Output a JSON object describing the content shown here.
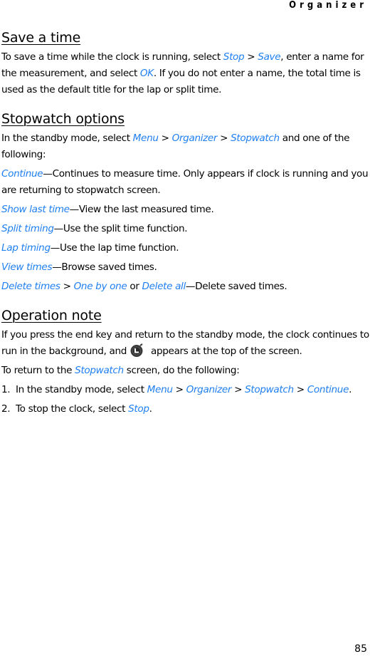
{
  "header": {
    "running_head": "Organizer"
  },
  "footer": {
    "page_number": "85"
  },
  "colors": {
    "link": "#1f7ff0",
    "text": "#000000"
  },
  "sections": {
    "save": {
      "title": "Save a time",
      "p1": {
        "t1": "To save a time while the clock is running, select ",
        "l1": "Stop",
        "t2": " > ",
        "l2": "Save",
        "t3": ", enter a name for the measurement, and select ",
        "l3": "OK",
        "t4": ". If you do not enter a name, the total time is used as the default title for the lap or split time."
      }
    },
    "options": {
      "title": "Stopwatch options",
      "intro": {
        "t1": "In the standby mode, select ",
        "l1": "Menu",
        "t2": " > ",
        "l2": "Organizer",
        "t3": " > ",
        "l3": "Stopwatch",
        "t4": " and one of the following:"
      },
      "items": [
        {
          "term": "Continue",
          "desc": "—Continues to measure time. Only appears if clock is running and you are returning to stopwatch screen."
        },
        {
          "term": "Show last time",
          "desc": "—View the last measured time."
        },
        {
          "term": "Split timing",
          "desc": "—Use the split time function."
        },
        {
          "term": "Lap timing",
          "desc": "—Use the lap time function."
        },
        {
          "term": "View times",
          "desc": "—Browse saved times."
        }
      ],
      "delete_item": {
        "l1": "Delete times",
        "t1": " > ",
        "l2": "One by one",
        "t2": " or ",
        "l3": "Delete all",
        "desc": "—Delete saved times."
      }
    },
    "note": {
      "title": "Operation note",
      "p1": {
        "t1": "If you press the end key and return to the standby mode, the clock continues to run in the background, and",
        "icon": "stopwatch-indicator-icon",
        "t2": "appears at the top of the screen."
      },
      "p2": {
        "t1": "To return to the ",
        "l1": "Stopwatch",
        "t2": " screen, do the following:"
      },
      "steps": [
        {
          "num": "1.",
          "t1": "In the standby mode, select ",
          "l1": "Menu",
          "t2": " > ",
          "l2": "Organizer",
          "t3": " > ",
          "l3": "Stopwatch",
          "t4": " > ",
          "l4": "Continue",
          "t5": "."
        },
        {
          "num": "2.",
          "t1": "To stop the clock, select ",
          "l1": "Stop",
          "t2": "."
        }
      ]
    }
  }
}
